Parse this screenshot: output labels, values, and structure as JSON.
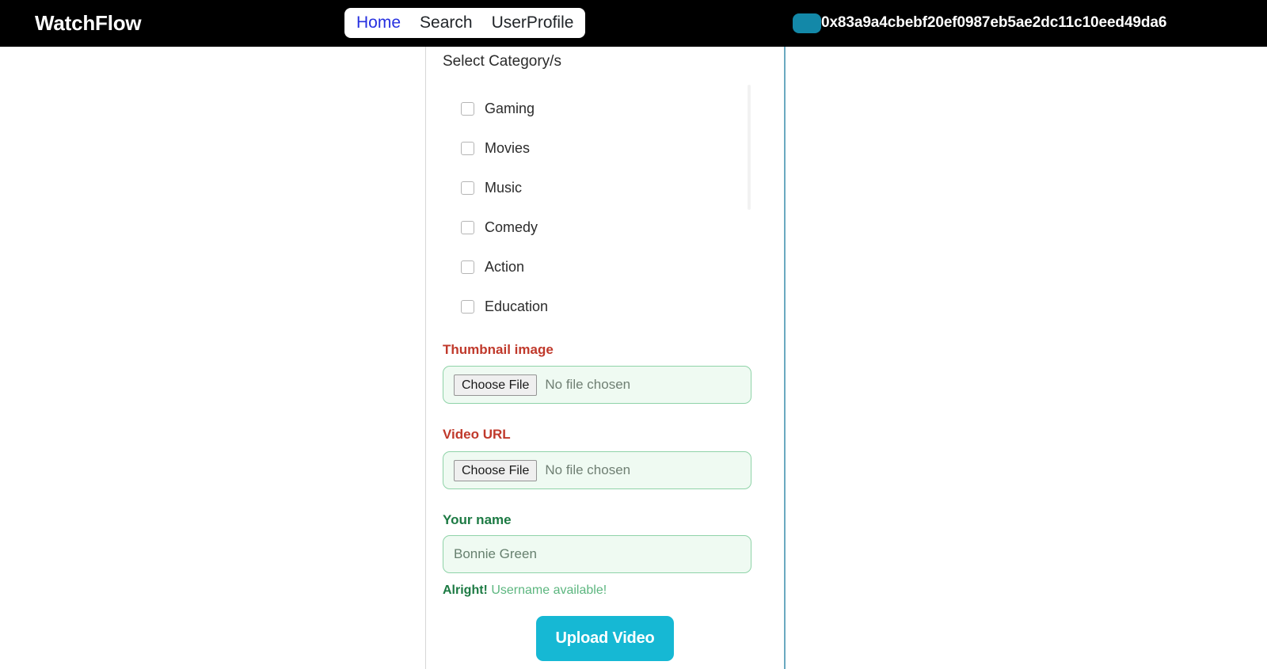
{
  "navbar": {
    "brand": "WatchFlow",
    "links": [
      {
        "label": "Home",
        "active": true
      },
      {
        "label": "Search",
        "active": false
      },
      {
        "label": "UserProfile",
        "active": false
      }
    ],
    "wallet": {
      "address": "0x83a9a4cbebf20ef0987eb5ae2dc11c10eed49da6",
      "avatar_color": "#1388a8"
    },
    "background_color": "#000000",
    "active_link_color": "#2630e0"
  },
  "form": {
    "category_section": {
      "label": "Select Category/s",
      "options": [
        {
          "label": "Gaming",
          "checked": false
        },
        {
          "label": "Movies",
          "checked": false
        },
        {
          "label": "Music",
          "checked": false
        },
        {
          "label": "Comedy",
          "checked": false
        },
        {
          "label": "Action",
          "checked": false
        },
        {
          "label": "Education",
          "checked": false
        }
      ]
    },
    "thumbnail_field": {
      "label": "Thumbnail image",
      "label_state": "invalid",
      "label_color": "#c0392b",
      "button_label": "Choose File",
      "file_status": "No file chosen"
    },
    "video_field": {
      "label": "Video URL",
      "label_state": "invalid",
      "label_color": "#c0392b",
      "button_label": "Choose File",
      "file_status": "No file chosen"
    },
    "name_field": {
      "label": "Your name",
      "label_state": "valid",
      "label_color": "#1c7a43",
      "value": "",
      "placeholder": "Bonnie Green",
      "helper_strong": "Alright!",
      "helper_text": "Username available!"
    },
    "submit": {
      "label": "Upload Video",
      "color": "#16b8d4"
    }
  }
}
